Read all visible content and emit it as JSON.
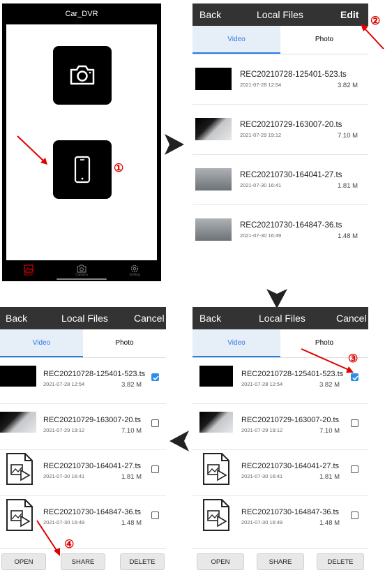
{
  "camera_app": {
    "title": "Car_DVR",
    "tabs": [
      {
        "label": "Album",
        "icon": "image-icon",
        "active": true
      },
      {
        "label": "Camera",
        "icon": "camera-icon",
        "active": false
      },
      {
        "label": "Setting",
        "icon": "gear-icon",
        "active": false
      }
    ]
  },
  "panel_top_right": {
    "back_label": "Back",
    "title": "Local Files",
    "action_label": "Edit",
    "tabs": [
      "Video",
      "Photo"
    ],
    "files": [
      {
        "name": "REC20210728-125401-523.ts",
        "date": "2021-07-28 12:54",
        "size": "3.82 M"
      },
      {
        "name": "REC20210729-163007-20.ts",
        "date": "2021-07-29 19:12",
        "size": "7.10 M"
      },
      {
        "name": "REC20210730-164041-27.ts",
        "date": "2021-07-30 16:41",
        "size": "1.81 M"
      },
      {
        "name": "REC20210730-164847-36.ts",
        "date": "2021-07-30 16:49",
        "size": "1.48 M"
      }
    ]
  },
  "panel_bottom_right": {
    "back_label": "Back",
    "title": "Local Files",
    "action_label": "Cancel",
    "tabs": [
      "Video",
      "Photo"
    ],
    "files": [
      {
        "name": "REC20210728-125401-523.ts",
        "date": "2021-07-28 12:54",
        "size": "3.82 M",
        "checked": true
      },
      {
        "name": "REC20210729-163007-20.ts",
        "date": "2021-07-29 19:12",
        "size": "7.10 M",
        "checked": false
      },
      {
        "name": "REC20210730-164041-27.ts",
        "date": "2021-07-30 16:41",
        "size": "1.81 M",
        "checked": false
      },
      {
        "name": "REC20210730-164847-36.ts",
        "date": "2021-07-30 16:49",
        "size": "1.48 M",
        "checked": false
      }
    ],
    "buttons": [
      "OPEN",
      "SHARE",
      "DELETE"
    ]
  },
  "panel_bottom_left": {
    "back_label": "Back",
    "title": "Local Files",
    "action_label": "Cancel",
    "tabs": [
      "Video",
      "Photo"
    ],
    "files": [
      {
        "name": "REC20210728-125401-523.ts",
        "date": "2021-07-28 12:54",
        "size": "3.82 M",
        "checked": true
      },
      {
        "name": "REC20210729-163007-20.ts",
        "date": "2021-07-29 19:12",
        "size": "7.10 M",
        "checked": false
      },
      {
        "name": "REC20210730-164041-27.ts",
        "date": "2021-07-30 16:41",
        "size": "1.81 M",
        "checked": false
      },
      {
        "name": "REC20210730-164847-36.ts",
        "date": "2021-07-30 16:49",
        "size": "1.48 M",
        "checked": false
      }
    ],
    "buttons": [
      "OPEN",
      "SHARE",
      "DELETE"
    ]
  },
  "annotations": {
    "step1": "①",
    "step2": "②",
    "step3": "③",
    "step4": "④"
  },
  "colors": {
    "header_bg": "#333333",
    "accent_blue": "#2a7ae4",
    "annotation_red": "#e00000",
    "album_tab_red": "#d40000"
  }
}
